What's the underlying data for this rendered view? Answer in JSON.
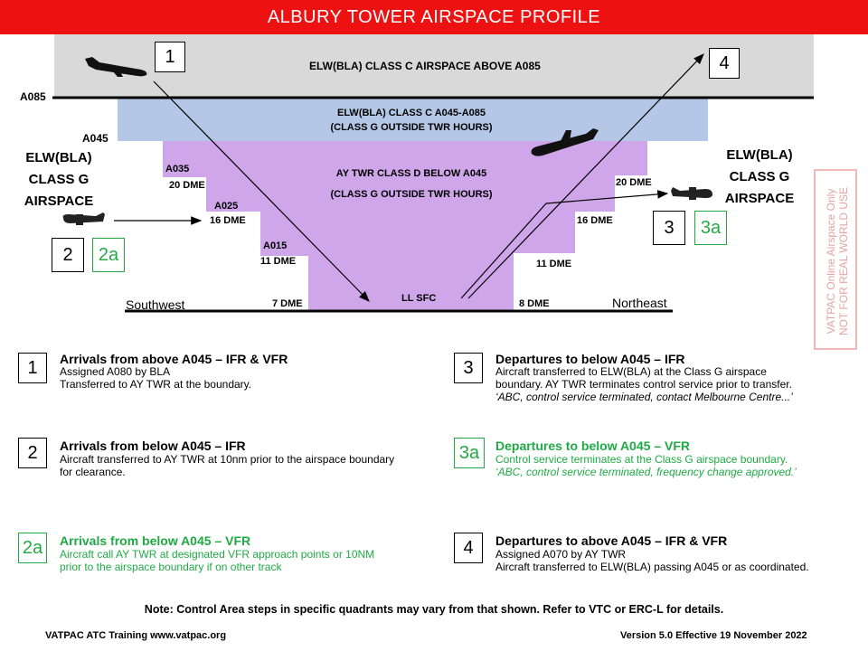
{
  "title": "ALBURY TOWER AIRSPACE PROFILE",
  "colors": {
    "title_bar": "#ee1111",
    "class_c_above": "#d9d9d9",
    "class_c_mid": "#b4c7e7",
    "class_d": "#cfa6ea",
    "green": "#1faa44"
  },
  "altitudes": {
    "a085": "A085",
    "a045": "A045",
    "a035": "A035",
    "a025": "A025",
    "a015": "A015"
  },
  "dme": {
    "d20_left": "20 DME",
    "d16_left": "16 DME",
    "d11_left": "11 DME",
    "d7_left": "7 DME",
    "d20_right": "20 DME",
    "d16_right": "16 DME",
    "d11_right": "11 DME",
    "d8_right": "8 DME"
  },
  "zones": {
    "class_c_above": "ELW(BLA) CLASS C AIRSPACE ABOVE A085",
    "class_c_mid_1": "ELW(BLA) CLASS C A045-A085",
    "class_c_mid_2": "(CLASS G OUTSIDE TWR HOURS)",
    "class_d_1": "AY TWR CLASS D BELOW A045",
    "class_d_2": "(CLASS G OUTSIDE TWR HOURS)",
    "sfc": "LL SFC",
    "class_g_left": [
      "ELW(BLA)",
      "CLASS G",
      "AIRSPACE"
    ],
    "class_g_right": [
      "ELW(BLA)",
      "CLASS G",
      "AIRSPACE"
    ]
  },
  "directions": {
    "southwest": "Southwest",
    "northeast": "Northeast"
  },
  "markers": {
    "m1": "1",
    "m2": "2",
    "m2a": "2a",
    "m3": "3",
    "m3a": "3a",
    "m4": "4"
  },
  "legend": [
    {
      "num": "1",
      "title": "Arrivals from above A045 – IFR & VFR",
      "lines": [
        "Assigned A080 by BLA",
        "Transferred to AY TWR at the boundary."
      ]
    },
    {
      "num": "2",
      "title": "Arrivals from below A045 – IFR",
      "lines": [
        "Aircraft transferred to AY TWR at 10nm prior to the airspace boundary",
        "for clearance."
      ]
    },
    {
      "num": "2a",
      "title": "Arrivals from below A045 – VFR",
      "lines": [
        "Aircraft call AY TWR at designated VFR approach points or 10NM",
        "prior to the airspace boundary if on other track"
      ]
    },
    {
      "num": "3",
      "title": "Departures to below A045 – IFR",
      "lines": [
        "Aircraft transferred to ELW(BLA) at the Class G airspace",
        "boundary. AY TWR terminates control service prior to transfer.",
        "‘ABC, control service terminated, contact Melbourne Centre...’"
      ]
    },
    {
      "num": "3a",
      "title": "Departures to below A045 – VFR",
      "lines": [
        "Control service terminates at the Class G airspace boundary.",
        "‘ABC, control service terminated, frequency change approved.’"
      ]
    },
    {
      "num": "4",
      "title": "Departures to above A045 – IFR & VFR",
      "lines": [
        "Assigned A070 by AY TWR",
        "Aircraft transferred to ELW(BLA) passing A045 or as coordinated."
      ]
    }
  ],
  "note": "Note: Control Area steps in specific quadrants may vary from that shown. Refer to VTC or ERC-L for details.",
  "footer_left": "VATPAC ATC Training www.vatpac.org",
  "footer_right": "Version 5.0 Effective 19 November 2022",
  "watermark": [
    "VATPAC Online Airspace Only",
    "NOT FOR REAL WORLD USE"
  ]
}
